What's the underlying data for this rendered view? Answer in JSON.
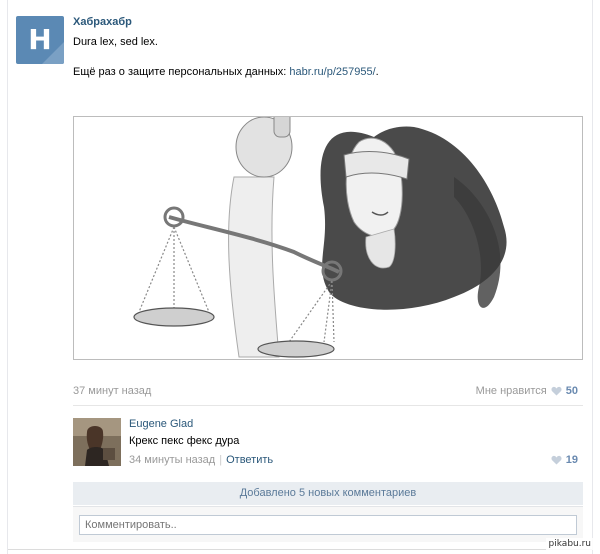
{
  "post": {
    "group_letter": "H",
    "author": "Хабрахабр",
    "line1": "Dura lex, sed lex.",
    "line2_prefix": "Ещё раз о защите персональных данных: ",
    "line2_link": "habr.ru/p/257955/",
    "line2_suffix": ".",
    "time": "37 минут назад",
    "like_label": "Мне нравится",
    "like_count": "50"
  },
  "comment": {
    "author": "Eugene Glad",
    "text": "Крекс пекс фекс дура",
    "time": "34 минуты назад",
    "reply_label": "Ответить",
    "like_count": "19"
  },
  "added_bar": "Добавлено 5 новых комментариев",
  "comment_input": {
    "placeholder": "Комментировать.."
  },
  "watermark": "pikabu.ru",
  "colors": {
    "link": "#2b587a",
    "avatar": "#5b89b4",
    "like": "#6a8ab0"
  }
}
